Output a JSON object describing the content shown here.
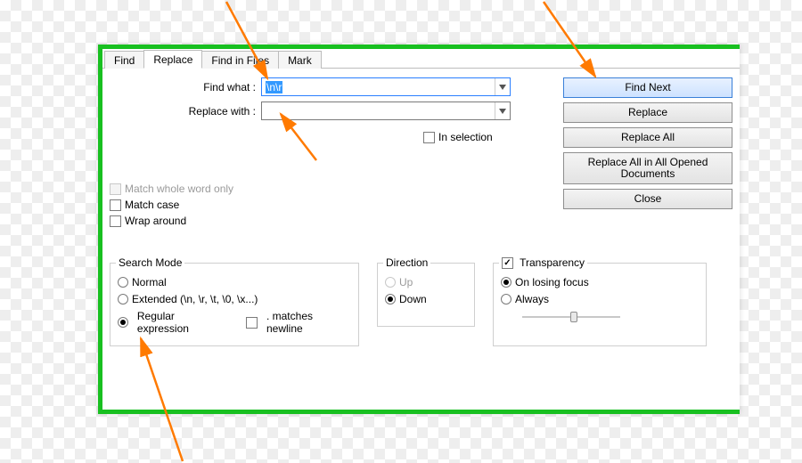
{
  "tabs": {
    "find": "Find",
    "replace": "Replace",
    "findinfiles": "Find in Files",
    "mark": "Mark",
    "active": "replace"
  },
  "fields": {
    "find_label": "Find what :",
    "find_value": "\\n\\r",
    "replace_label": "Replace with :",
    "replace_value": ""
  },
  "buttons": {
    "find_next": "Find Next",
    "replace": "Replace",
    "replace_all": "Replace All",
    "replace_all_docs": "Replace All in All Opened Documents",
    "close": "Close"
  },
  "inselection": "In selection",
  "options": {
    "match_word": "Match whole word only",
    "match_case": "Match case",
    "wrap": "Wrap around"
  },
  "search_mode": {
    "legend": "Search Mode",
    "normal": "Normal",
    "extended": "Extended (\\n, \\r, \\t, \\0, \\x...)",
    "regex": "Regular expression",
    "matches_newline": ". matches newline",
    "selected": "regex"
  },
  "direction": {
    "legend": "Direction",
    "up": "Up",
    "down": "Down",
    "selected": "down"
  },
  "transparency": {
    "legend": "Transparency",
    "enabled": true,
    "on_losing_focus": "On losing focus",
    "always": "Always",
    "selected": "on_losing_focus"
  },
  "icons": {
    "dropdown": "chevron-down-icon"
  },
  "colors": {
    "dialog_border": "#18c020",
    "arrow": "#ff7a00",
    "default_btn": "#3a80d8"
  }
}
